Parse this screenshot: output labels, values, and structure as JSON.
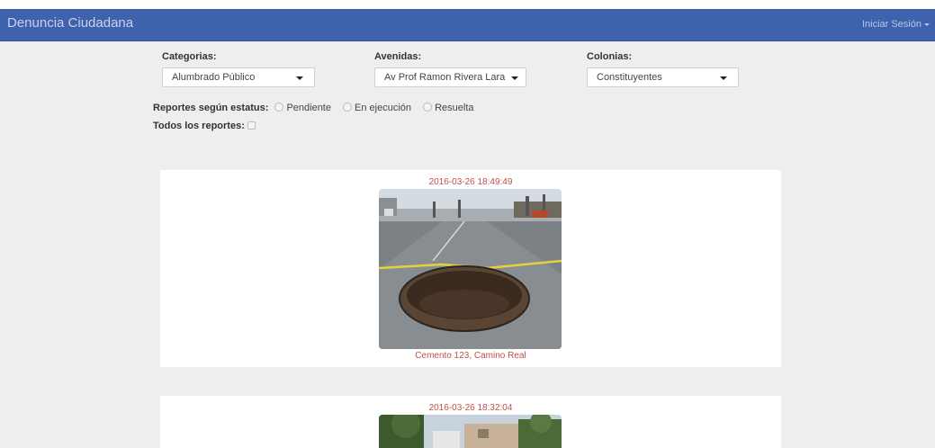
{
  "navbar": {
    "brand": "Denuncia Ciudadana",
    "login_label": "Iniciar Sesión"
  },
  "filters": {
    "categorias": {
      "label": "Categorias:",
      "selected": "Alumbrado Público"
    },
    "avenidas": {
      "label": "Avenidas:",
      "selected": "Av Prof Ramon Rivera Lara"
    },
    "colonias": {
      "label": "Colonias:",
      "selected": "Constituyentes"
    }
  },
  "status": {
    "label": "Reportes según estatus:",
    "options": [
      "Pendiente",
      "En ejecución",
      "Resuelta"
    ]
  },
  "all_reports": {
    "label": "Todos los reportes:"
  },
  "reports": [
    {
      "datetime": "2016-03-26 18:49:49",
      "location": "Cemento 123, Camino Real"
    },
    {
      "datetime": "2016-03-26 18:32:04",
      "location": ""
    }
  ],
  "colors": {
    "navbar": "#3f62ad",
    "accent_text": "#c0504d",
    "background": "#eeeeee"
  }
}
